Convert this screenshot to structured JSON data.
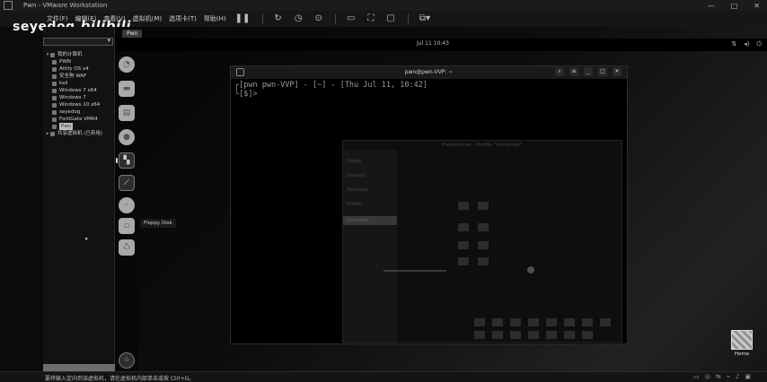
{
  "window": {
    "title": "Pwn - VMware Workstation"
  },
  "watermark": {
    "text": "seyedog",
    "logo": "bilibili"
  },
  "menu": {
    "items": [
      "文件(F)",
      "编辑(E)",
      "查看(V)",
      "虚拟机(M)",
      "选项卡(T)",
      "帮助(H)"
    ]
  },
  "toolbar": {
    "icons": [
      "pause-icon",
      "snapshot-icon",
      "revert-icon",
      "manage-snapshots-icon",
      "fit-guest-icon",
      "fullscreen-icon",
      "unity-icon",
      "console-view-icon"
    ]
  },
  "library": {
    "root_label": "我的计算机",
    "items": [
      {
        "label": "PWN"
      },
      {
        "label": "Attify OS x4"
      },
      {
        "label": "安全狗 WAF"
      },
      {
        "label": "kali"
      },
      {
        "label": "Windows 7 x64"
      },
      {
        "label": "Windows 7"
      },
      {
        "label": "Windows 10 x64"
      },
      {
        "label": "seyedog"
      },
      {
        "label": "FortiGate VM64"
      },
      {
        "label": "Pwn",
        "selected": true
      }
    ],
    "shared_label": "共享虚拟机 (已弃用)"
  },
  "guest": {
    "tab_label": "Pwn",
    "clock": "Jul 11  10:43",
    "dock_tooltip": "Floppy Disk",
    "desktop_icon_label": "Home"
  },
  "terminal": {
    "title": "pwn@pwn-VVP: ~",
    "prompt_line": "┌[pwn pwn-VVP] - [~] - [Thu Jul 11, 10:42]",
    "second_line": "└[$]>"
  },
  "prefs_dialog": {
    "title": "Preferences – Profile \"Unnamed\"",
    "sidebar": [
      "Global",
      "General",
      "Shortcuts",
      "Profiles",
      "Unnamed"
    ]
  },
  "status": {
    "text": "要将输入定向到该虚拟机，请在虚拟机内部单击或按 Ctrl+G。"
  },
  "colors": {
    "background": "#050505",
    "terminal_bg": "#000000",
    "accent": "#bdbdbd"
  }
}
